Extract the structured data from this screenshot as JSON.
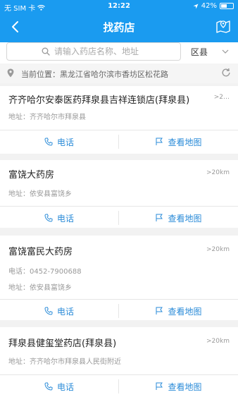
{
  "status": {
    "carrier": "无 SIM 卡",
    "time": "12:22",
    "battery_percent": "42%",
    "battery_level": 0.42
  },
  "header": {
    "title": "找药店"
  },
  "search": {
    "placeholder": "请输入药店名称、地址",
    "district": "区县"
  },
  "location": {
    "label": "当前位置：",
    "value": "黑龙江省哈尔滨市香坊区松花路"
  },
  "stores": [
    {
      "name": "齐齐哈尔安泰医药拜泉县吉祥连锁店(拜泉县)",
      "distance": ">2…",
      "phone": "",
      "address": "地址：齐齐哈尔市拜泉县"
    },
    {
      "name": "富饶大药房",
      "distance": ">20km",
      "phone": "",
      "address": "地址：依安县富饶乡"
    },
    {
      "name": "富饶富民大药房",
      "distance": ">20km",
      "phone": "电话：0452-7900688",
      "address": "地址：依安县富饶乡"
    },
    {
      "name": "拜泉县健玺堂药店(拜泉县)",
      "distance": ">20km",
      "phone": "",
      "address": "地址：齐齐哈尔市拜泉县人民街附近"
    }
  ],
  "actions": {
    "call": "电话",
    "map": "查看地图"
  }
}
